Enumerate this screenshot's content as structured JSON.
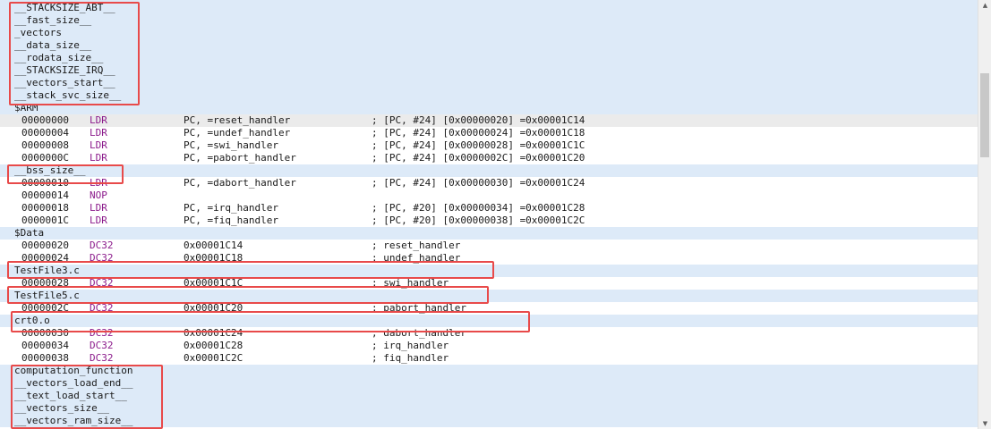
{
  "rows": [
    {
      "t": "sym",
      "label": "__STACKSIZE_ABT__"
    },
    {
      "t": "sym",
      "label": "__fast_size__"
    },
    {
      "t": "sym",
      "label": "_vectors"
    },
    {
      "t": "sym",
      "label": "__data_size__"
    },
    {
      "t": "sym",
      "label": "__rodata_size__"
    },
    {
      "t": "sym",
      "label": "__STACKSIZE_IRQ__"
    },
    {
      "t": "sym",
      "label": "__vectors_start__"
    },
    {
      "t": "sym",
      "label": "__stack_svc_size__"
    },
    {
      "t": "head",
      "label": "$ARM"
    },
    {
      "t": "sel",
      "addr": "00000000",
      "mn": "LDR",
      "op": "PC, =reset_handler",
      "cm": "; [PC, #24] [0x00000020] =0x00001C14"
    },
    {
      "t": "src",
      "addr": "00000004",
      "mn": "LDR",
      "op": "PC, =undef_handler",
      "cm": "; [PC, #24] [0x00000024] =0x00001C18"
    },
    {
      "t": "src",
      "addr": "00000008",
      "mn": "LDR",
      "op": "PC, =swi_handler",
      "cm": "; [PC, #24] [0x00000028] =0x00001C1C"
    },
    {
      "t": "src",
      "addr": "0000000C",
      "mn": "LDR",
      "op": "PC, =pabort_handler",
      "cm": "; [PC, #24] [0x0000002C] =0x00001C20"
    },
    {
      "t": "sym",
      "label": "__bss_size__"
    },
    {
      "t": "src",
      "addr": "00000010",
      "mn": "LDR",
      "op": "PC, =dabort_handler",
      "cm": "; [PC, #24] [0x00000030] =0x00001C24"
    },
    {
      "t": "src",
      "addr": "00000014",
      "mn": "NOP",
      "op": "",
      "cm": ""
    },
    {
      "t": "src",
      "addr": "00000018",
      "mn": "LDR",
      "op": "PC, =irq_handler",
      "cm": "; [PC, #20] [0x00000034] =0x00001C28"
    },
    {
      "t": "src",
      "addr": "0000001C",
      "mn": "LDR",
      "op": "PC, =fiq_handler",
      "cm": "; [PC, #20] [0x00000038] =0x00001C2C"
    },
    {
      "t": "head",
      "label": "$Data"
    },
    {
      "t": "src",
      "addr": "00000020",
      "mn": "DC32",
      "op": "0x00001C14",
      "cm": "; reset_handler"
    },
    {
      "t": "src",
      "addr": "00000024",
      "mn": "DC32",
      "op": "0x00001C18",
      "cm": "; undef_handler"
    },
    {
      "t": "sym",
      "label": "TestFile3.c"
    },
    {
      "t": "src",
      "addr": "00000028",
      "mn": "DC32",
      "op": "0x00001C1C",
      "cm": "; swi_handler"
    },
    {
      "t": "sym",
      "label": "TestFile5.c"
    },
    {
      "t": "src",
      "addr": "0000002C",
      "mn": "DC32",
      "op": "0x00001C20",
      "cm": "; pabort_handler"
    },
    {
      "t": "sym",
      "label": "crt0.o"
    },
    {
      "t": "src",
      "addr": "00000030",
      "mn": "DC32",
      "op": "0x00001C24",
      "cm": "; dabort_handler"
    },
    {
      "t": "src",
      "addr": "00000034",
      "mn": "DC32",
      "op": "0x00001C28",
      "cm": "; irq_handler"
    },
    {
      "t": "src",
      "addr": "00000038",
      "mn": "DC32",
      "op": "0x00001C2C",
      "cm": "; fiq_handler"
    },
    {
      "t": "sym",
      "label": "computation_function"
    },
    {
      "t": "sym",
      "label": "__vectors_load_end__"
    },
    {
      "t": "sym",
      "label": "__text_load_start__"
    },
    {
      "t": "sym",
      "label": "__vectors_size__"
    },
    {
      "t": "sym",
      "label": "__vectors_ram_size__"
    }
  ],
  "colors": {
    "symbol_bg": "#ddeaf8",
    "mnemonic": "#8b1a8b",
    "highlight": "#e84a4a",
    "selected_bg": "#ebebeb"
  },
  "scrollbar": {
    "up_icon": "triangle-up",
    "down_icon": "triangle-down",
    "up_glyph": "▲",
    "down_glyph": "▼"
  }
}
